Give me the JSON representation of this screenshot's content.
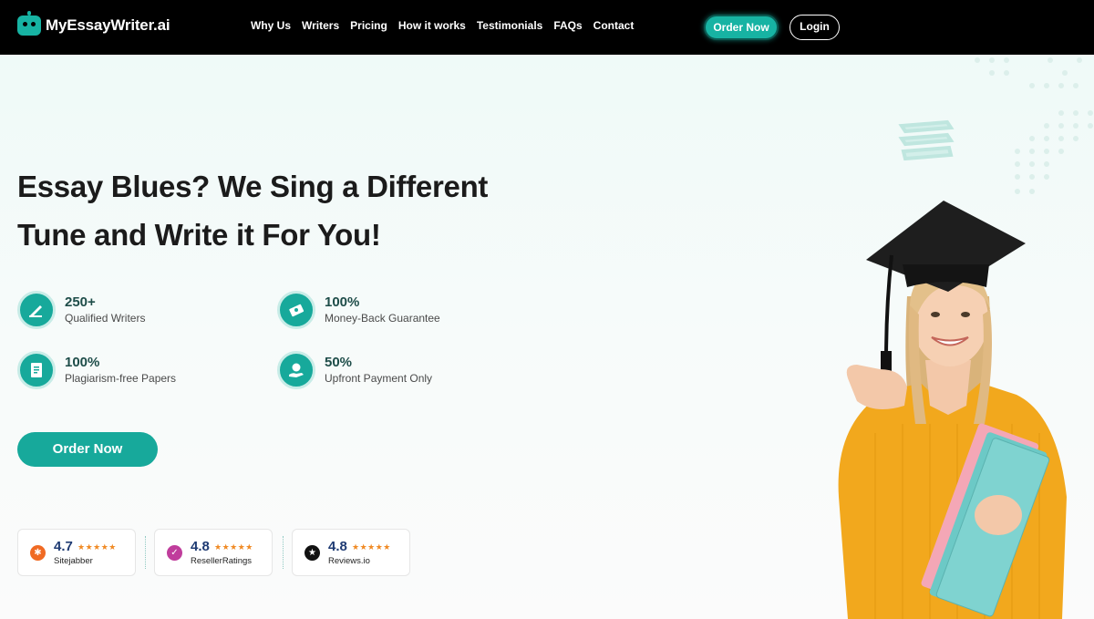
{
  "brand": {
    "name": "MyEssayWriter.ai"
  },
  "nav": {
    "links": [
      "Why Us",
      "Writers",
      "Pricing",
      "How it works",
      "Testimonials",
      "FAQs",
      "Contact"
    ],
    "order_label": "Order Now",
    "login_label": "Login"
  },
  "hero": {
    "title_line1": "Essay Blues? We Sing a Different",
    "title_line2": "Tune and Write it For You!",
    "features": [
      {
        "value": "250+",
        "label": "Qualified Writers",
        "icon": "writer-icon"
      },
      {
        "value": "100%",
        "label": "Money-Back Guarantee",
        "icon": "money-icon"
      },
      {
        "value": "100%",
        "label": "Plagiarism-free Papers",
        "icon": "document-icon"
      },
      {
        "value": "50%",
        "label": "Upfront Payment Only",
        "icon": "payment-icon"
      }
    ],
    "order_label": "Order Now"
  },
  "ratings": [
    {
      "score": "4.7",
      "stars": "★★★★★",
      "name": "Sitejabber",
      "color": "#f06a23"
    },
    {
      "score": "4.8",
      "stars": "★★★★★",
      "name": "ResellerRatings",
      "color": "#c03d9c"
    },
    {
      "score": "4.8",
      "stars": "★★★★★",
      "name": "Reviews.io",
      "color": "#111111"
    }
  ],
  "colors": {
    "accent": "#17a99b",
    "nav_bg": "#000000"
  }
}
